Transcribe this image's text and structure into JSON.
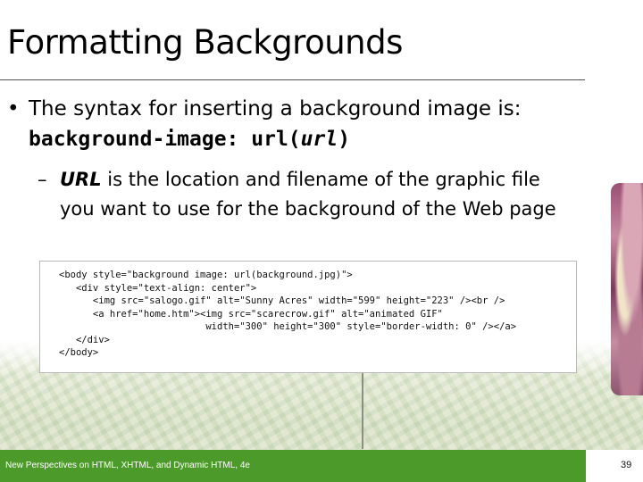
{
  "slide": {
    "title": "Formatting Backgrounds",
    "bullet": {
      "marker": "•",
      "text": "The syntax for inserting a background image is:",
      "code_prefix": "background-image: url(",
      "code_arg": "url",
      "code_suffix": ")"
    },
    "sub_bullet": {
      "marker": "–",
      "bold_term": "URL",
      "line1": " is the location and filename of the graphic file",
      "line2": "you want to use for the background of the Web page"
    },
    "code_figure": {
      "lines": [
        "<body style=\"background image: url(background.jpg)\">",
        "   <div style=\"text-align: center\">",
        "      <img src=\"salogo.gif\" alt=\"Sunny Acres\" width=\"599\" height=\"223\" /><br />",
        "      <a href=\"home.htm\"><img src=\"scarecrow.gif\" alt=\"animated GIF\"",
        "                          width=\"300\" height=\"300\" style=\"border-width: 0\" /></a>",
        "   </div>",
        "</body>"
      ]
    },
    "footer": {
      "text": "New Perspectives on HTML, XHTML, and Dynamic HTML, 4e",
      "page_number": "39"
    },
    "colors": {
      "footer_bar": "#4c9a2a",
      "title_rule": "#4f4f4f"
    }
  }
}
